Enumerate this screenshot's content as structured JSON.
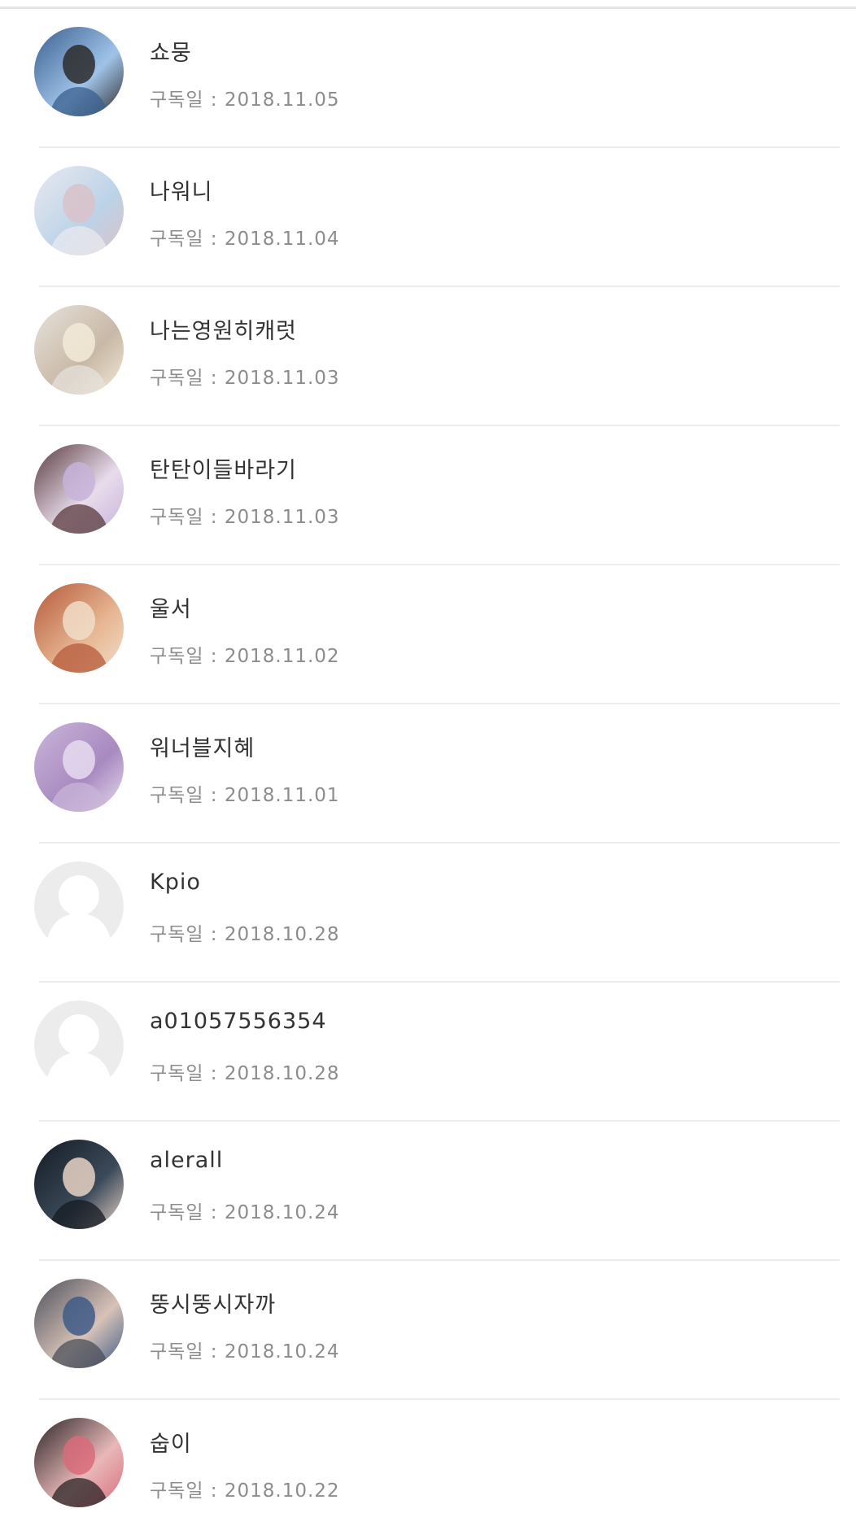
{
  "subscribers": [
    {
      "name": "쇼뭉",
      "date_label": "구독일",
      "date": "2018.11.05",
      "avatar": "photo",
      "avatar_colors": [
        "#3a5f8f",
        "#9fc3e8",
        "#2b2b2b"
      ]
    },
    {
      "name": "나워니",
      "date_label": "구독일",
      "date": "2018.11.04",
      "avatar": "photo",
      "avatar_colors": [
        "#e9e9ef",
        "#bcd3e8",
        "#d9c2c9"
      ]
    },
    {
      "name": "나는영원히캐럿",
      "date_label": "구독일",
      "date": "2018.11.03",
      "avatar": "photo",
      "avatar_colors": [
        "#e6e2dc",
        "#c9b8a6",
        "#f3ead8"
      ]
    },
    {
      "name": "탄탄이들바라기",
      "date_label": "구독일",
      "date": "2018.11.03",
      "avatar": "photo",
      "avatar_colors": [
        "#5a3a3e",
        "#e8dcec",
        "#c7b3d9"
      ]
    },
    {
      "name": "울서",
      "date_label": "구독일",
      "date": "2018.11.02",
      "avatar": "photo",
      "avatar_colors": [
        "#b5593a",
        "#e7b692",
        "#f1ddc8"
      ]
    },
    {
      "name": "워너블지혜",
      "date_label": "구독일",
      "date": "2018.11.01",
      "avatar": "photo",
      "avatar_colors": [
        "#c9b6d8",
        "#a889c0",
        "#e6dcee"
      ]
    },
    {
      "name": "Kpio",
      "date_label": "구독일",
      "date": "2018.10.28",
      "avatar": "default",
      "avatar_colors": [
        "#ececec",
        "#ffffff",
        "#ffffff"
      ]
    },
    {
      "name": "a01057556354",
      "date_label": "구독일",
      "date": "2018.10.28",
      "avatar": "default",
      "avatar_colors": [
        "#ececec",
        "#ffffff",
        "#ffffff"
      ]
    },
    {
      "name": "alerall",
      "date_label": "구독일",
      "date": "2018.10.24",
      "avatar": "photo",
      "avatar_colors": [
        "#141a22",
        "#3b4a5a",
        "#e8d2c4"
      ]
    },
    {
      "name": "뚱시뚱시자까",
      "date_label": "구독일",
      "date": "2018.10.24",
      "avatar": "photo",
      "avatar_colors": [
        "#4b4f5a",
        "#d8c2b8",
        "#3e5a86"
      ]
    },
    {
      "name": "숩이",
      "date_label": "구독일",
      "date": "2018.10.22",
      "avatar": "photo",
      "avatar_colors": [
        "#2a2325",
        "#e8b8b8",
        "#d96b7a"
      ]
    }
  ]
}
